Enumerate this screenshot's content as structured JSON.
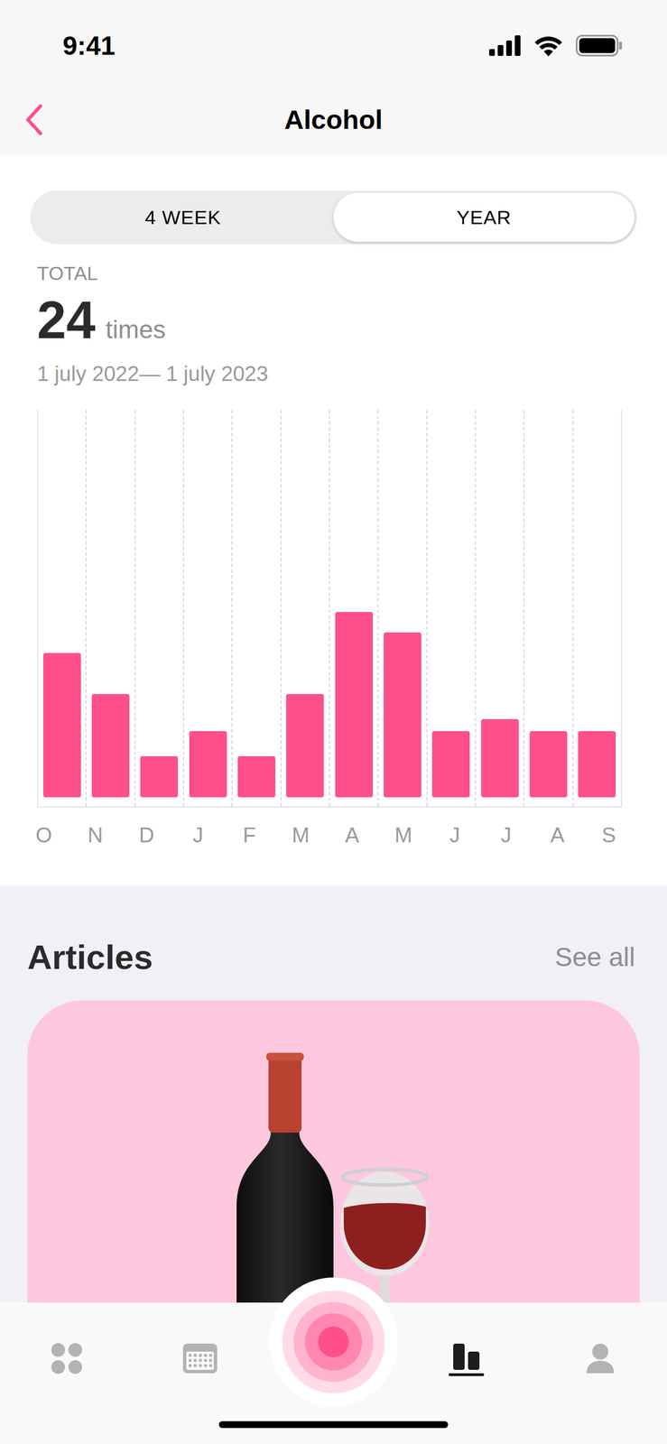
{
  "status_bar": {
    "time": "9:41"
  },
  "header": {
    "title": "Alcohol"
  },
  "period_tabs": [
    {
      "label": "4 WEEK",
      "selected": false
    },
    {
      "label": "YEAR",
      "selected": true
    }
  ],
  "summary": {
    "label": "TOTAL",
    "value": "24",
    "unit": "times",
    "range": "1 july 2022— 1 july 2023"
  },
  "chart": {
    "x_labels": [
      "O",
      "N",
      "D",
      "J",
      "F",
      "M",
      "A",
      "M",
      "J",
      "J",
      "A",
      "S"
    ],
    "max": 9.4,
    "values": [
      3.5,
      2.5,
      1,
      1.6,
      1,
      2.5,
      4.5,
      4,
      1.6,
      1.9,
      1.6,
      1.6
    ]
  },
  "articles": {
    "title": "Articles",
    "see_all": "See all"
  },
  "nav": [
    {
      "selected": false
    },
    {
      "selected": false
    },
    {
      "selected": false
    },
    {
      "selected": true
    },
    {
      "selected": false
    }
  ]
}
